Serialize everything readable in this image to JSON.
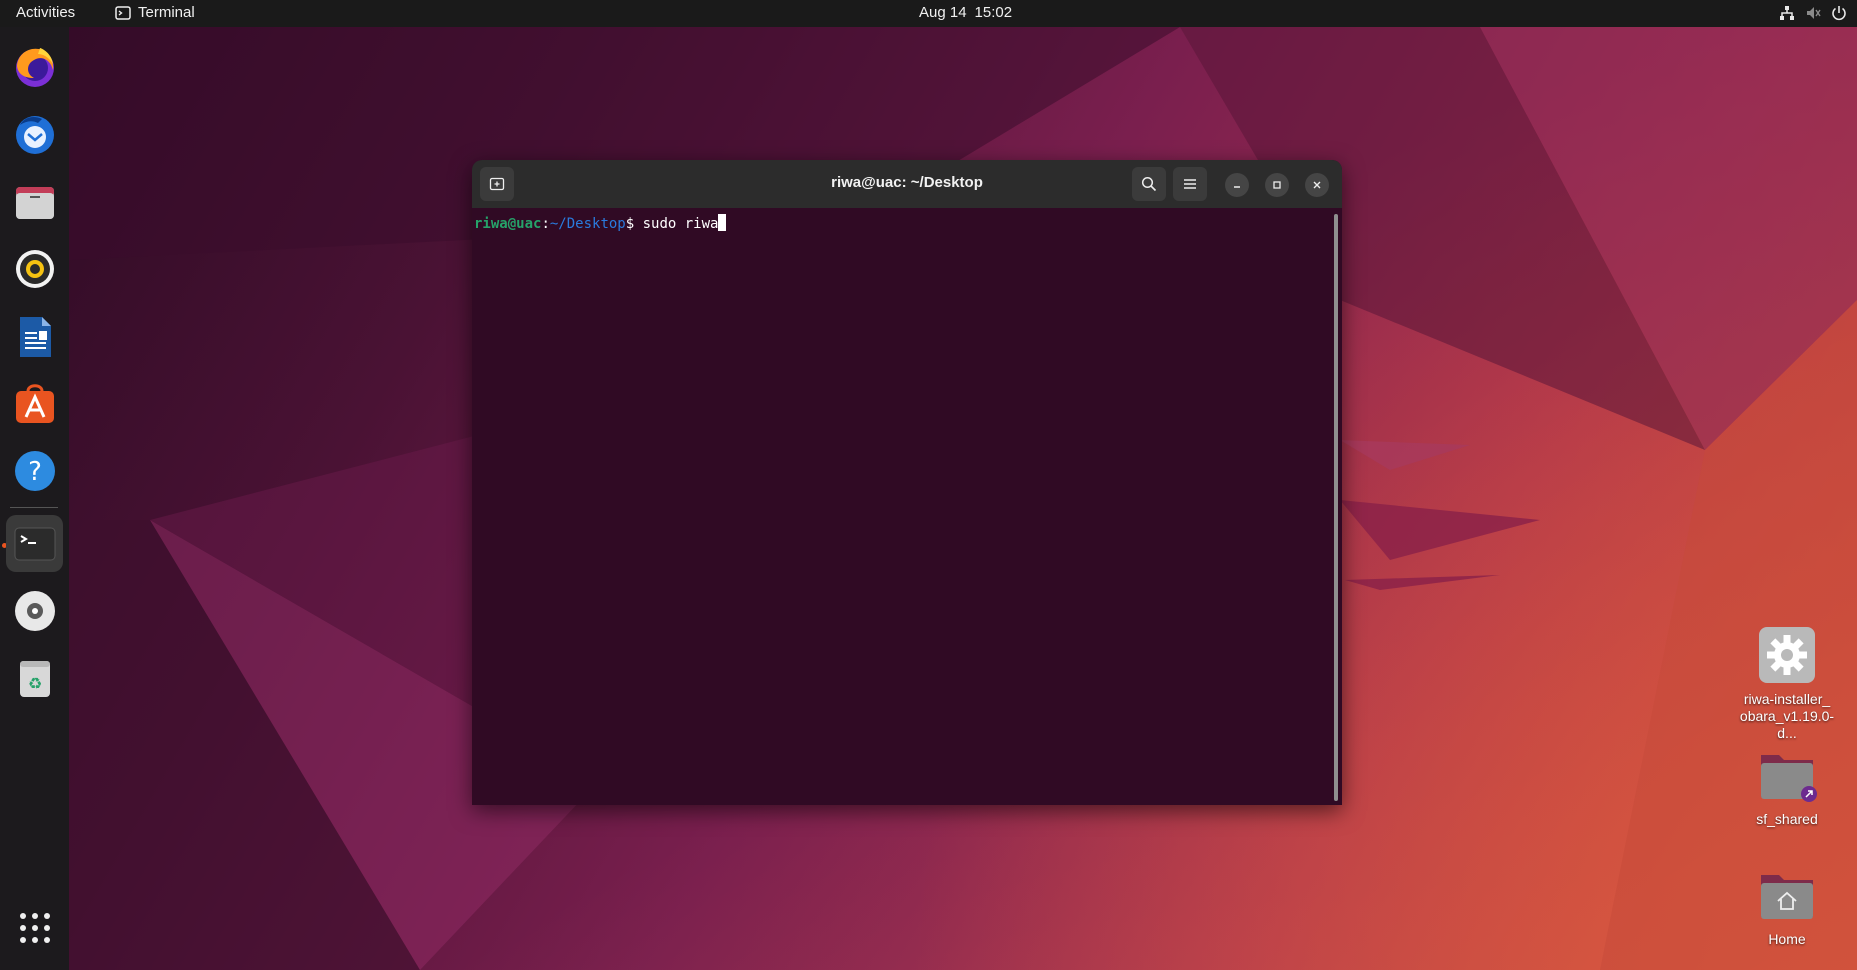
{
  "topbar": {
    "activities": "Activities",
    "app_name": "Terminal",
    "date": "Aug 14",
    "time": "15:02"
  },
  "dock": {
    "items": [
      {
        "name": "firefox",
        "icon": "firefox-icon"
      },
      {
        "name": "thunderbird",
        "icon": "thunderbird-icon"
      },
      {
        "name": "files",
        "icon": "files-icon"
      },
      {
        "name": "rhythmbox",
        "icon": "rhythmbox-icon"
      },
      {
        "name": "libreoffice-writer",
        "icon": "writer-icon"
      },
      {
        "name": "app-center",
        "icon": "app-center-icon"
      },
      {
        "name": "help",
        "icon": "help-icon"
      },
      {
        "name": "terminal",
        "icon": "terminal-icon",
        "active": true
      },
      {
        "name": "disc",
        "icon": "disc-icon"
      },
      {
        "name": "trash",
        "icon": "trash-icon"
      },
      {
        "name": "show-apps",
        "icon": "app-grid-icon"
      }
    ],
    "colors": {
      "running_indicator": "#e95420",
      "background": "#1c1a1d"
    }
  },
  "terminal": {
    "title": "riwa@uac: ~/Desktop",
    "prompt_user": "riwa@uac",
    "prompt_sep": ":",
    "prompt_path": "~/Desktop",
    "prompt_symbol": "$",
    "command": " sudo riwa",
    "colors": {
      "background": "#300a24",
      "header": "#2c2c2c",
      "user": "#26a269",
      "path": "#2a7bde"
    }
  },
  "desktop_icons": [
    {
      "label": "riwa-installer_obara_v1.19.0-d...",
      "label_line1": "riwa-installer_",
      "label_line2": "obara_v1.19.0-d...",
      "icon": "gear-icon"
    },
    {
      "label": "sf_shared",
      "icon": "folder-link-icon"
    },
    {
      "label": "Home",
      "icon": "home-folder-icon"
    }
  ]
}
